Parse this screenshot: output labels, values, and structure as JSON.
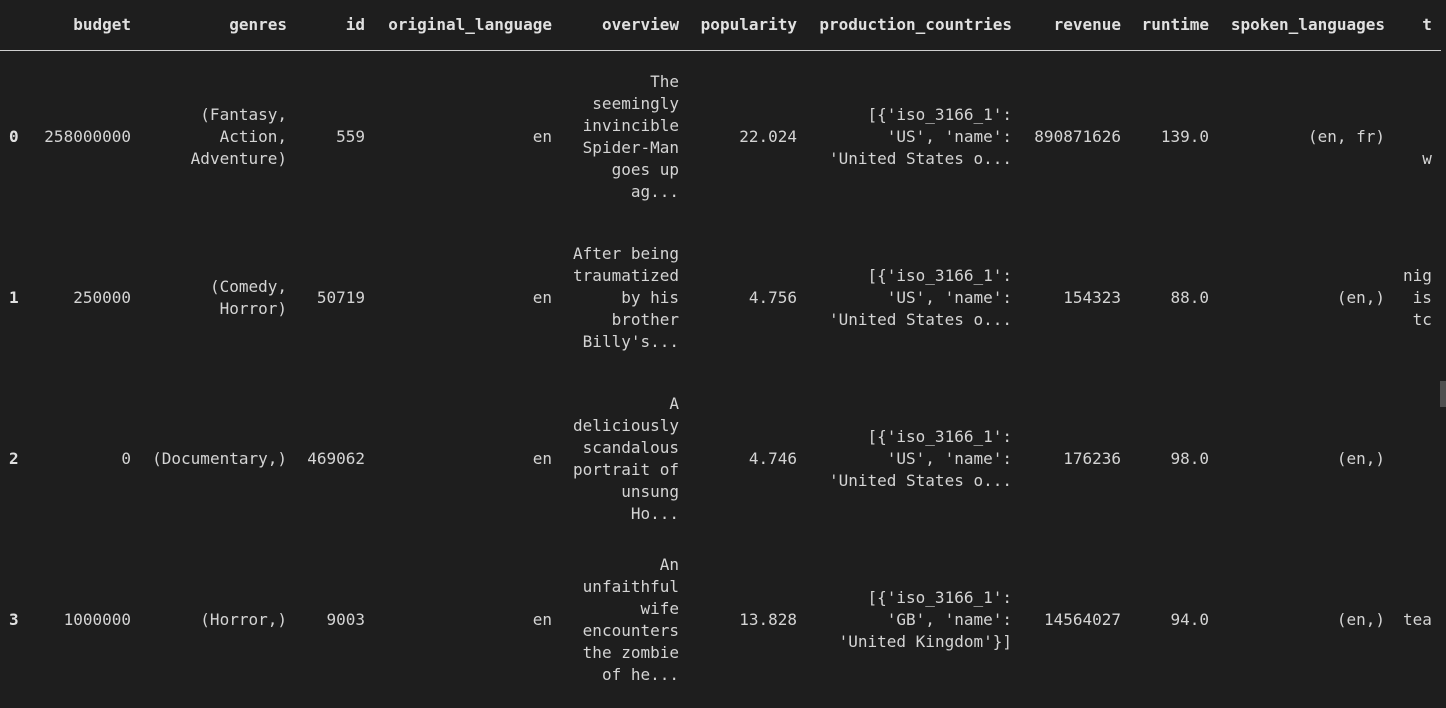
{
  "columns": [
    "budget",
    "genres",
    "id",
    "original_language",
    "overview",
    "popularity",
    "production_countries",
    "revenue",
    "runtime",
    "spoken_languages",
    "t"
  ],
  "rows": [
    {
      "index": "0",
      "budget": "258000000",
      "genres": "(Fantasy,\nAction,\nAdventure)",
      "id": "559",
      "original_language": "en",
      "overview": "The\nseemingly\ninvincible\nSpider-Man\ngoes up\nag...",
      "popularity": "22.024",
      "production_countries": "[{'iso_3166_1':\n'US', 'name':\n'United States o...",
      "revenue": "890871626",
      "runtime": "139.0",
      "spoken_languages": "(en, fr)",
      "trunc": "\n\nw"
    },
    {
      "index": "1",
      "budget": "250000",
      "genres": "(Comedy,\nHorror)",
      "id": "50719",
      "original_language": "en",
      "overview": "After being\ntraumatized\nby his\nbrother\nBilly's...",
      "popularity": "4.756",
      "production_countries": "[{'iso_3166_1':\n'US', 'name':\n'United States o...",
      "revenue": "154323",
      "runtime": "88.0",
      "spoken_languages": "(en,)",
      "trunc": "nig\nis\ntc"
    },
    {
      "index": "2",
      "budget": "0",
      "genres": "(Documentary,)",
      "id": "469062",
      "original_language": "en",
      "overview": "A\ndeliciously\nscandalous\nportrait of\nunsung\nHo...",
      "popularity": "4.746",
      "production_countries": "[{'iso_3166_1':\n'US', 'name':\n'United States o...",
      "revenue": "176236",
      "runtime": "98.0",
      "spoken_languages": "(en,)",
      "trunc": ""
    },
    {
      "index": "3",
      "budget": "1000000",
      "genres": "(Horror,)",
      "id": "9003",
      "original_language": "en",
      "overview": "An\nunfaithful\nwife\nencounters\nthe zombie\nof he...",
      "popularity": "13.828",
      "production_countries": "[{'iso_3166_1':\n'GB', 'name':\n'United Kingdom'}]",
      "revenue": "14564027",
      "runtime": "94.0",
      "spoken_languages": "(en,)",
      "trunc": "tea"
    }
  ],
  "colors": {
    "background": "#1e1e1e",
    "text": "#d4d4d4",
    "header_rule": "#cfcfcf"
  }
}
